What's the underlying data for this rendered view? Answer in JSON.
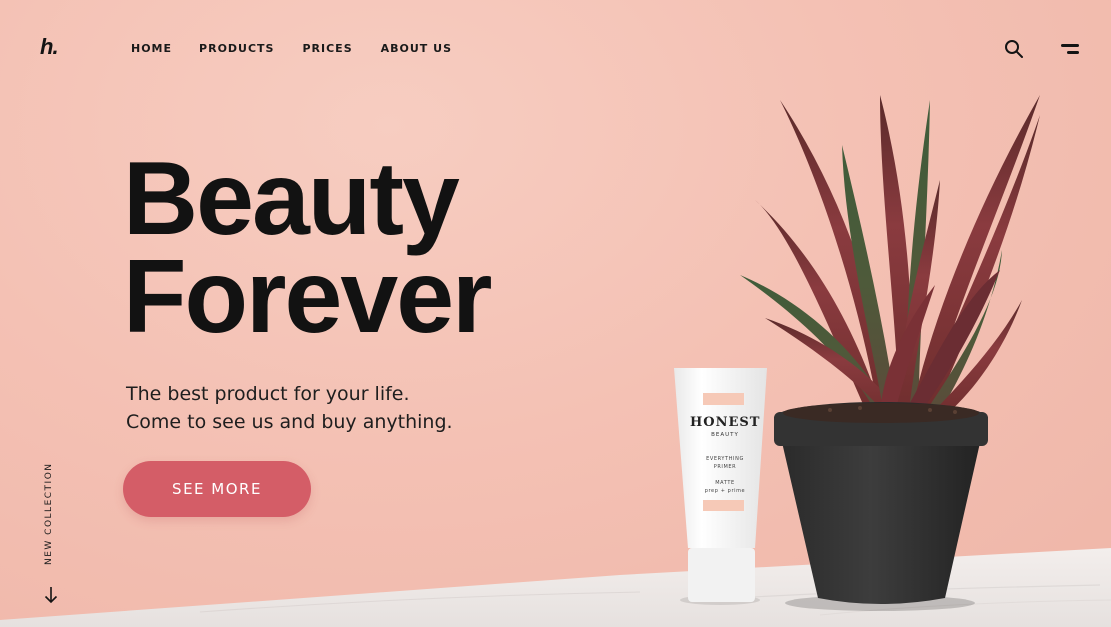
{
  "header": {
    "logo": "h.",
    "nav": [
      {
        "label": "HOME"
      },
      {
        "label": "PRODUCTS"
      },
      {
        "label": "PRICES"
      },
      {
        "label": "ABOUT US"
      }
    ],
    "icons": [
      "search-icon",
      "menu-icon"
    ]
  },
  "hero": {
    "title_line1": "Beauty",
    "title_line2": "Forever",
    "subtitle_line1": "The best product for your life.",
    "subtitle_line2": "Come to see us and buy anything.",
    "cta_label": "SEE MORE",
    "side_label": "NEW COLLECTION"
  },
  "product": {
    "brand": "HONEST",
    "brand_sub": "BEAUTY",
    "line1": "EVERYTHING",
    "line2": "PRIMER",
    "line3": "MATTE",
    "line4": "prep + prime"
  },
  "colors": {
    "background": "#f4c1b4",
    "accent": "#d45d67",
    "text": "#121212"
  }
}
